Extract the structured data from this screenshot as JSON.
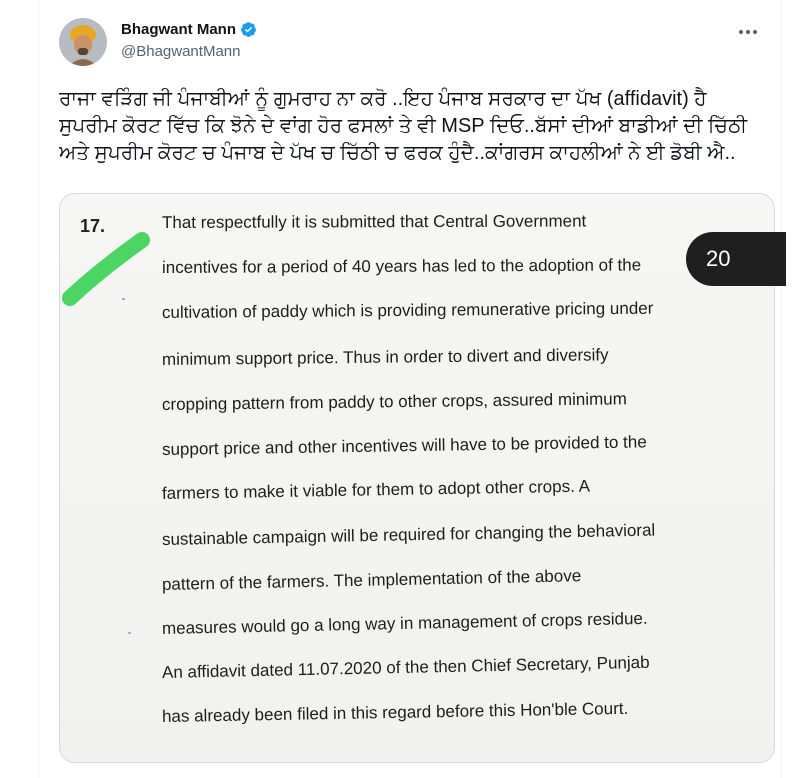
{
  "tweet": {
    "author_name": "Bhagwant Mann",
    "handle": "@BhagwantMann",
    "more_icon": "more-horizontal-icon",
    "verified_color": "#1d9bf0",
    "text_lines": [
      "ਰਾਜਾ ਵੜਿੰਗ ਜੀ ਪੰਜਾਬੀਆਂ ਨੂੰ ਗੁਮਰਾਹ ਨਾ ਕਰੋ ..ਇਹ ਪੰਜਾਬ ਸਰਕਾਰ ਦਾ ਪੱਖ (affidavit) ਹੈ",
      "ਸੁਪਰੀਮ ਕੋਰਟ ਵਿੱਚ ਕਿ ਝੋਨੇ ਦੇ ਵਾਂਗ ਹੋਰ ਫਸਲਾਂ ਤੇ ਵੀ MSP ਦਿਓ..ਬੱਸਾਂ ਦੀਆਂ ਬਾਡੀਆਂ ਦੀ ਚਿੱਠੀ",
      "ਅਤੇ ਸੁਪਰੀਮ ਕੋਰਟ ਚ ਪੰਜਾਬ ਦੇ ਪੱਖ ਚ ਚਿੱਠੀ ਚ ਫਰਕ ਹੁੰਦੈ..ਕਾਂਗਰਸ ਕਾਹਲੀਆਂ ਨੇ ਈ ਡੋਬੀ ਐ.."
    ]
  },
  "media": {
    "photo_counter": "20",
    "paragraph_number": "17.",
    "document_lines": [
      "That respectfully it is submitted that Central Government",
      "incentives for a period of 40 years has led to the adoption of the",
      "cultivation of paddy which is providing remunerative pricing under",
      "minimum support price. Thus in order to divert and diversify",
      "cropping pattern from paddy to other crops, assured minimum",
      "support price and other incentives will have to be provided to the",
      "farmers to make it viable for them to adopt other crops. A",
      "sustainable campaign will be required for changing the behavioral",
      "pattern of the farmers. The implementation of the above",
      "measures would go a long way in management of crops residue.",
      "An affidavit dated 11.07.2020 of the then Chief Secretary, Punjab",
      "has already been filed in this regard before this Hon'ble Court."
    ],
    "highlight_color": "#39d353"
  }
}
